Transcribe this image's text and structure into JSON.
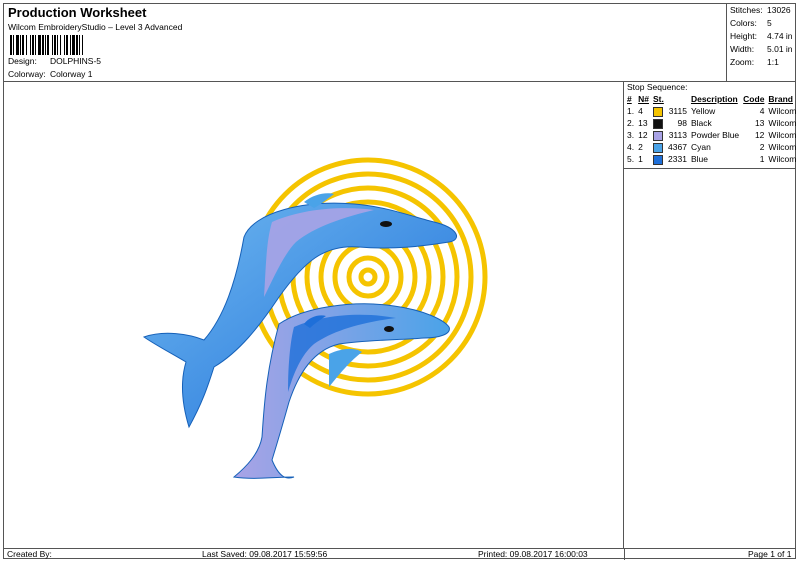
{
  "header": {
    "title": "Production Worksheet",
    "subtitle": "Wilcom EmbroideryStudio – Level 3 Advanced",
    "design_label": "Design:",
    "design_value": "DOLPHINS-5",
    "colorway_label": "Colorway:",
    "colorway_value": "Colorway 1"
  },
  "stats": [
    {
      "label": "Stitches:",
      "value": "13026"
    },
    {
      "label": "Colors:",
      "value": "5"
    },
    {
      "label": "Height:",
      "value": "4.74 in"
    },
    {
      "label": "Width:",
      "value": "5.01 in"
    },
    {
      "label": "Zoom:",
      "value": "1:1"
    }
  ],
  "stop_sequence": {
    "title": "Stop Sequence:",
    "columns": [
      "#",
      "N#",
      "St.",
      "Description",
      "Code",
      "Brand"
    ],
    "rows": [
      {
        "idx": "1.",
        "n": "4",
        "color": "#F5C400",
        "st": "3115",
        "description": "Yellow",
        "code": "4",
        "brand": "Wilcom"
      },
      {
        "idx": "2.",
        "n": "13",
        "color": "#111111",
        "st": "98",
        "description": "Black",
        "code": "13",
        "brand": "Wilcom"
      },
      {
        "idx": "3.",
        "n": "12",
        "color": "#A9A3E6",
        "st": "3113",
        "description": "Powder Blue",
        "code": "12",
        "brand": "Wilcom"
      },
      {
        "idx": "4.",
        "n": "2",
        "color": "#4AA3E8",
        "st": "4367",
        "description": "Cyan",
        "code": "2",
        "brand": "Wilcom"
      },
      {
        "idx": "5.",
        "n": "1",
        "color": "#1E6FD9",
        "st": "2331",
        "description": "Blue",
        "code": "1",
        "brand": "Wilcom"
      }
    ]
  },
  "footer": {
    "created_by": "Created By:",
    "last_saved": "Last Saved: 09.08.2017 15:59:56",
    "printed": "Printed: 09.08.2017 16:00:03",
    "page": "Page 1 of 1"
  },
  "colors": {
    "yellow": "#F5C400",
    "cyan": "#4AA3E8",
    "blue": "#1E6FD9",
    "powder_blue": "#A9A3E6"
  }
}
